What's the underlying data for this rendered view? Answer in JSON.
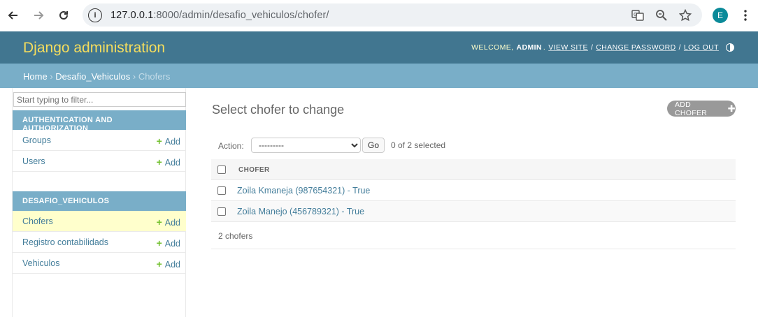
{
  "browser": {
    "url_host": "127.0.0.1",
    "url_rest": ":8000/admin/desafio_vehiculos/chofer/",
    "profile_initial": "E"
  },
  "header": {
    "branding": "Django administration",
    "welcome": "WELCOME,",
    "username": "ADMIN",
    "view_site": "VIEW SITE",
    "change_password": "CHANGE PASSWORD",
    "log_out": "LOG OUT"
  },
  "breadcrumbs": {
    "home": "Home",
    "app": "Desafio_Vehiculos",
    "current": "Chofers"
  },
  "sidebar": {
    "filter_placeholder": "Start typing to filter...",
    "modules": [
      {
        "caption": "AUTHENTICATION AND AUTHORIZATION",
        "models": [
          {
            "name": "Groups",
            "add": "Add"
          },
          {
            "name": "Users",
            "add": "Add"
          }
        ]
      },
      {
        "caption": "DESAFIO_VEHICULOS",
        "models": [
          {
            "name": "Chofers",
            "add": "Add"
          },
          {
            "name": "Registro contabilidads",
            "add": "Add"
          },
          {
            "name": "Vehiculos",
            "add": "Add"
          }
        ]
      }
    ]
  },
  "content": {
    "title": "Select chofer to change",
    "add_button": "ADD CHOFER",
    "action_label": "Action:",
    "action_selected": "---------",
    "go_label": "Go",
    "selection_counter": "0 of 2 selected",
    "column_header": "CHOFER",
    "rows": [
      "Zoila Kmaneja (987654321) - True",
      "Zoila Manejo (456789321) - True"
    ],
    "paginator": "2 chofers"
  },
  "colors": {
    "header_bg": "#417690",
    "branding": "#f5dd5d",
    "breadcrumbs_bg": "#79aec8",
    "link": "#447e9b",
    "add_plus": "#70bf2b",
    "current_model_bg": "#ffffcc"
  }
}
